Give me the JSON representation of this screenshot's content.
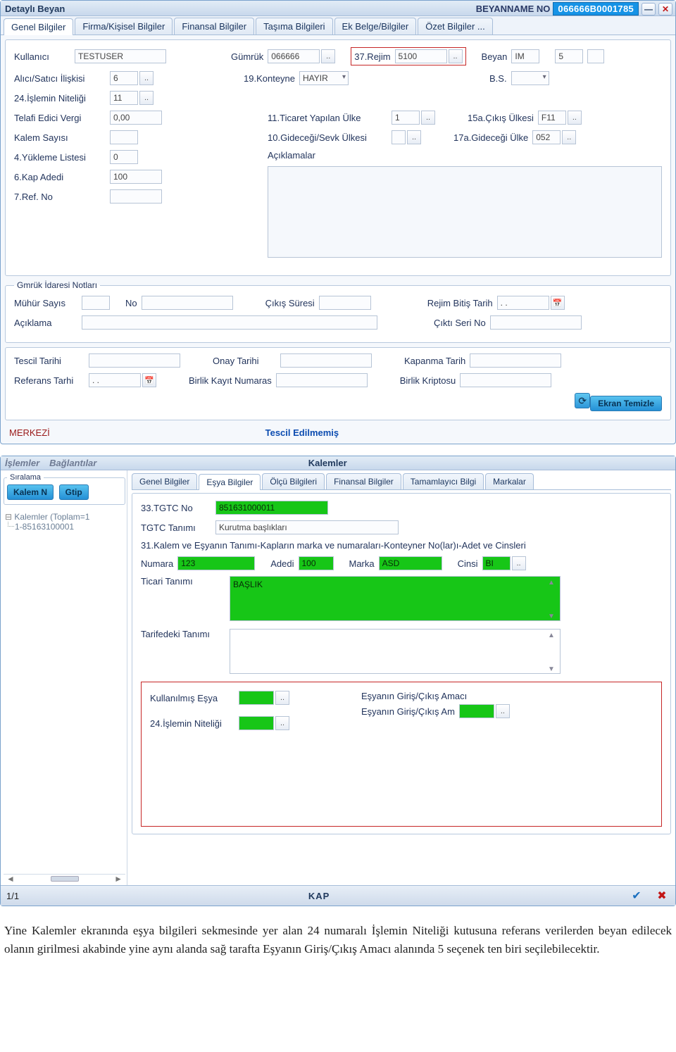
{
  "window1": {
    "title": "Detaylı Beyan",
    "beyname_label": "BEYANNAME NO",
    "beyname_no": "066666B0001785",
    "tabs": [
      "Genel Bilgiler",
      "Firma/Kişisel Bilgiler",
      "Finansal Bilgiler",
      "Taşıma Bilgileri",
      "Ek Belge/Bilgiler",
      "Özet Bilgiler  ..."
    ],
    "fields": {
      "kullanici_label": "Kullanıcı",
      "kullanici": "TESTUSER",
      "gumruk_label": "Gümrük",
      "gumruk": "066666",
      "rejim_label": "37.Rejim",
      "rejim": "5100",
      "beyan_label": "Beyan",
      "beyan_code": "IM",
      "beyan_num": "5",
      "alici_label": "Alıcı/Satıcı İlişkisi",
      "alici": "6",
      "konteyner_label": "19.Konteyne",
      "konteyner": "HAYIR",
      "bs_label": "B.S.",
      "islem_nitelik_label": "24.İşlemin Niteliği",
      "islem_nitelik": "11",
      "ticaret_ulke_label": "11.Ticaret Yapılan Ülke",
      "ticaret_ulke": "1",
      "cikis_ulkesi_label": "15a.Çıkış Ülkesi",
      "cikis_ulkesi": "F11",
      "gidecek_sevk_label": "10.Gideceği/Sevk Ülkesi",
      "gidecek_ulke_label": "17a.Gideceği Ülke",
      "gidecek_ulke": "052",
      "telafi_label": "Telafi Edici Vergi",
      "telafi": "0,00",
      "kalem_sayisi_label": "Kalem Sayısı",
      "yuk_listesi_label": "4.Yükleme Listesi",
      "yuk_listesi": "0",
      "kap_adedi_label": "6.Kap Adedi",
      "kap_adedi": "100",
      "ref_no_label": "7.Ref. No",
      "aciklamalar_label": "Açıklamalar"
    },
    "notes": {
      "legend": "Gmrük İdaresi Notları",
      "muhur_label": "Mühür Sayıs",
      "no_label": "No",
      "cikis_suresi_label": "Çıkış Süresi",
      "rejim_bitis_label": "Rejim Bitiş Tarih",
      "rejim_bitis": ". .",
      "aciklama_label": "Açıklama",
      "cikti_seri_label": "Çıktı Seri No"
    },
    "bottom": {
      "tescil_label": "Tescil Tarihi",
      "onay_label": "Onay Tarihi",
      "kapanma_label": "Kapanma Tarih",
      "ref_tarih_label": "Referans Tarhi",
      "ref_tarih": ". .",
      "birlik_kayit_label": "Birlik Kayıt Numaras",
      "birlik_kripto_label": "Birlik Kriptosu",
      "ekran_temizle": "Ekran Temizle"
    },
    "status_left": "MERKEZİ",
    "status_center": "Tescil Edilmemiş"
  },
  "window2": {
    "menu_left": "İşlemler",
    "menu_left2": "Bağlantılar",
    "title": "Kalemler",
    "sidebar": {
      "siralama_legend": "Sıralama",
      "btn_kalem": "Kalem N",
      "btn_gtip": "Gtip",
      "tree_root": "Kalemler (Toplam=1",
      "tree_leaf": "1-85163100001"
    },
    "tabs": [
      "Genel Bilgiler",
      "Eşya Bilgiler",
      "Ölçü Bilgileri",
      "Finansal Bilgiler",
      "Tamamlayıcı Bilgi",
      "Markalar"
    ],
    "esya": {
      "tgtc_no_label": "33.TGTC No",
      "tgtc_no": "851631000011",
      "tgtc_tanim_label": "TGTC Tanımı",
      "tgtc_tanim": "Kurutma başlıkları",
      "desc31": "31.Kalem ve Eşyanın Tanımı-Kapların marka ve numaraları-Konteyner No(lar)ı-Adet ve Cinsleri",
      "numara_label": "Numara",
      "numara": "123",
      "adedi_label": "Adedi",
      "adedi": "100",
      "marka_label": "Marka",
      "marka": "ASD",
      "cinsi_label": "Cinsi",
      "cinsi": "BI",
      "ticari_tanim_label": "Ticari Tanımı",
      "ticari_tanim": "BAŞLIK",
      "tarifedeki_label": "Tarifedeki Tanımı",
      "kullanilmis_label": "Kullanılmış Eşya",
      "islem24_label": "24.İşlemin Niteliği",
      "egca_header": "Eşyanın Giriş/Çıkış Amacı",
      "egca_field": "Eşyanın Giriş/Çıkış Am"
    },
    "footer": {
      "left": "1/1",
      "center": "KAP"
    }
  },
  "caption": "Yine Kalemler ekranında eşya bilgileri sekmesinde yer alan 24 numaralı İşlemin Niteliği kutusuna referans verilerden beyan edilecek olanın girilmesi akabinde yine aynı alanda sağ tarafta Eşyanın Giriş/Çıkış Amacı alanında 5 seçenek ten biri seçilebilecektir."
}
